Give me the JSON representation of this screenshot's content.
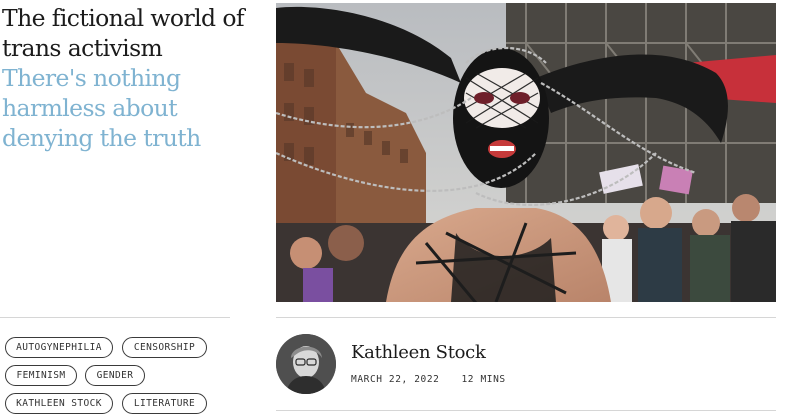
{
  "article": {
    "title": "The fictional world of trans activism",
    "subtitle": "There's nothing harmless about denying the truth"
  },
  "tags": [
    "AUTOGYNEPHILIA",
    "CENSORSHIP",
    "FEMINISM",
    "GENDER",
    "KATHLEEN STOCK",
    "LITERATURE"
  ],
  "author": {
    "name": "Kathleen Stock",
    "date": "MARCH 22, 2022",
    "read_time": "12 MINS"
  },
  "colors": {
    "title": "#1b1b1b",
    "subtitle": "#7fb3d1",
    "divider": "#d6d6d6"
  }
}
